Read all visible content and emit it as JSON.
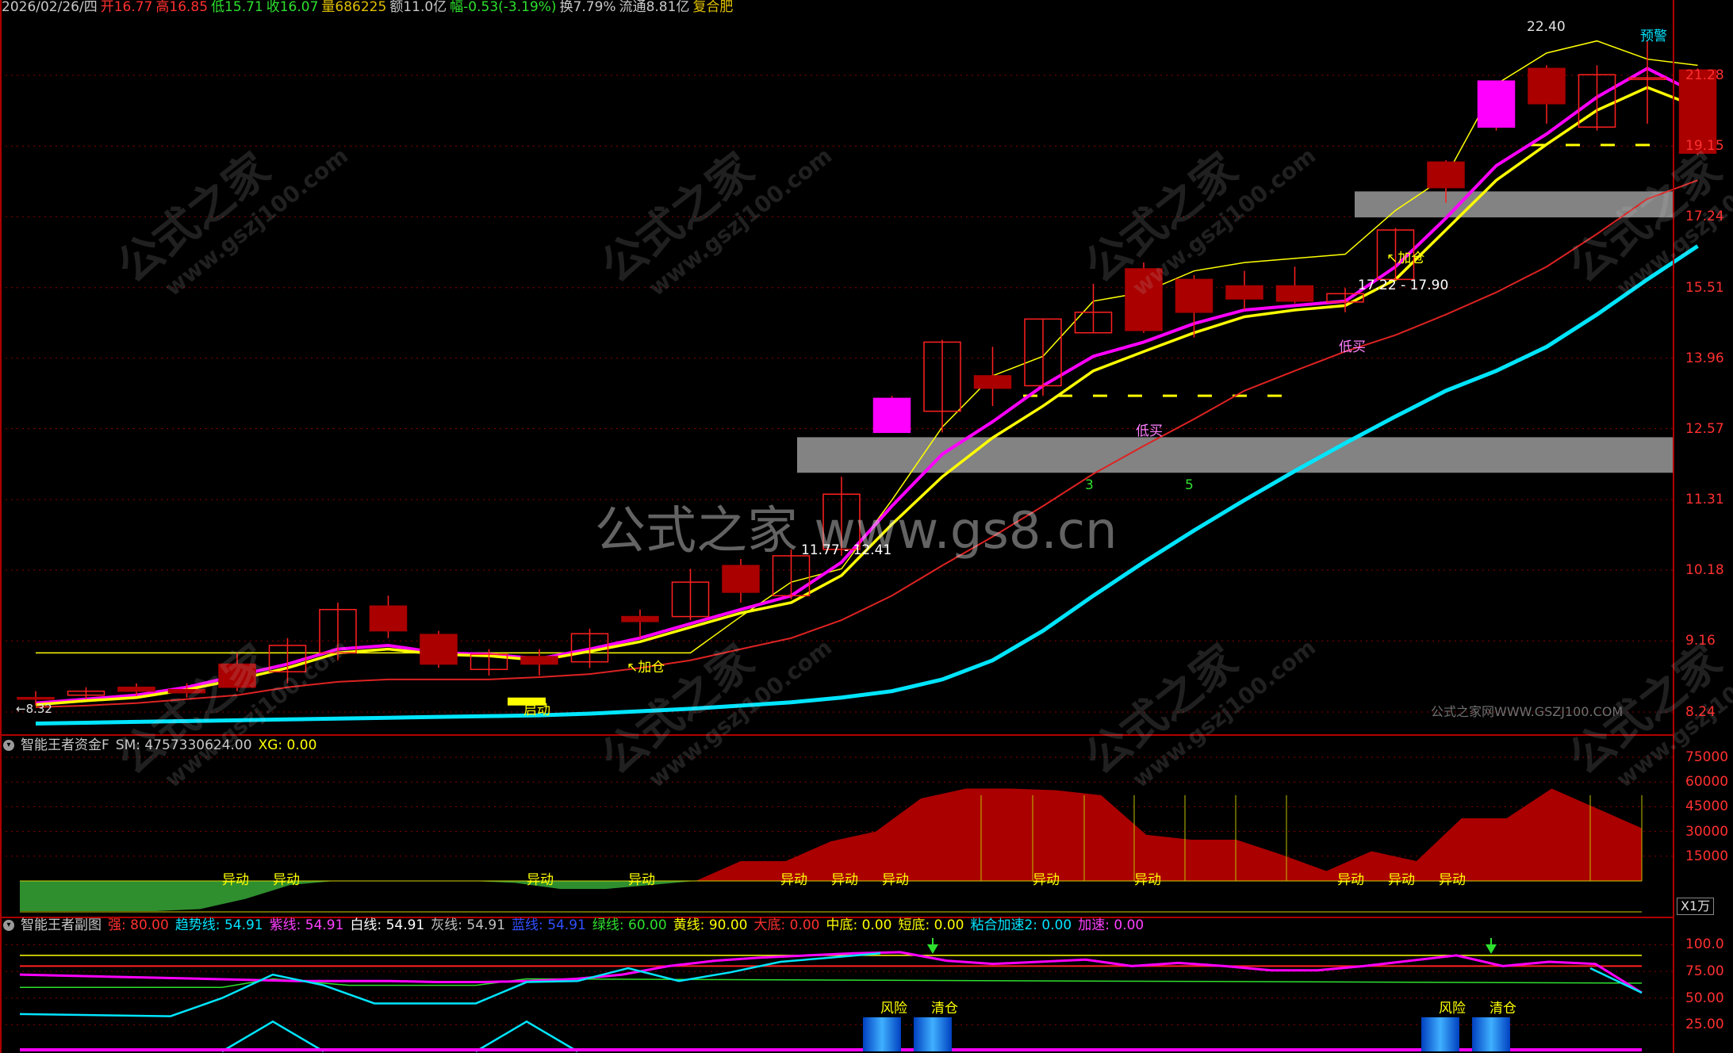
{
  "info_bar": {
    "date": "2026/02/26/四",
    "open": "开16.77",
    "high": "高16.85",
    "low": "低15.71",
    "close": "收16.07",
    "volume": "量686225",
    "amount": "额11.0亿",
    "change": "幅-0.53(-3.19%)",
    "turnover": "换7.79%",
    "float": "流通8.81亿",
    "name": "复合肥"
  },
  "main_chart": {
    "price_axis": [
      "21.28",
      "19.15",
      "17.24",
      "15.51",
      "13.96",
      "12.57",
      "11.31",
      "10.18",
      "9.16",
      "8.24"
    ],
    "labels": {
      "peak": "22.40",
      "warn": "预警",
      "add1": "↖加仓",
      "add2": "↖加仓",
      "range1": "17.22 - 17.90",
      "range2": "11.77 - 12.41",
      "low_buy1": "低买",
      "low_buy2": "低买",
      "start": "启动",
      "low_mark": "←8.32",
      "n3": "3",
      "n5": "5",
      "source": "公式之家网WWW.GSZJ100.COM"
    },
    "candles": [
      {
        "o": 8.42,
        "c": 8.4,
        "h": 8.5,
        "l": 8.32
      },
      {
        "o": 8.45,
        "c": 8.5,
        "h": 8.55,
        "l": 8.4
      },
      {
        "o": 8.55,
        "c": 8.5,
        "h": 8.6,
        "l": 8.44
      },
      {
        "o": 8.52,
        "c": 8.48,
        "h": 8.6,
        "l": 8.42
      },
      {
        "o": 8.85,
        "c": 8.55,
        "h": 9.0,
        "l": 8.5
      },
      {
        "o": 8.75,
        "c": 9.1,
        "h": 9.2,
        "l": 8.6
      },
      {
        "o": 9.0,
        "c": 9.6,
        "h": 9.7,
        "l": 8.9
      },
      {
        "o": 9.65,
        "c": 9.3,
        "h": 9.8,
        "l": 9.2
      },
      {
        "o": 9.25,
        "c": 8.85,
        "h": 9.3,
        "l": 8.8
      },
      {
        "o": 8.78,
        "c": 8.98,
        "h": 9.05,
        "l": 8.7
      },
      {
        "o": 8.95,
        "c": 8.85,
        "h": 9.05,
        "l": 8.7
      },
      {
        "o": 8.88,
        "c": 9.26,
        "h": 9.33,
        "l": 8.8
      },
      {
        "o": 9.5,
        "c": 9.43,
        "h": 9.6,
        "l": 9.2
      },
      {
        "o": 9.5,
        "c": 10.0,
        "h": 10.2,
        "l": 9.45
      },
      {
        "o": 10.25,
        "c": 9.85,
        "h": 10.35,
        "l": 9.7
      },
      {
        "o": 9.8,
        "c": 10.4,
        "h": 10.5,
        "l": 9.75
      },
      {
        "o": 10.5,
        "c": 11.4,
        "h": 11.7,
        "l": 10.4
      },
      {
        "o": 12.5,
        "c": 13.15,
        "h": 13.2,
        "l": 12.5
      },
      {
        "o": 12.9,
        "c": 14.3,
        "h": 14.35,
        "l": 12.5
      },
      {
        "o": 13.6,
        "c": 13.35,
        "h": 14.2,
        "l": 13.0
      },
      {
        "o": 13.4,
        "c": 14.8,
        "h": 14.8,
        "l": 13.2
      },
      {
        "o": 14.5,
        "c": 14.95,
        "h": 15.6,
        "l": 14.5
      },
      {
        "o": 15.95,
        "c": 14.55,
        "h": 16.1,
        "l": 14.5
      },
      {
        "o": 15.7,
        "c": 14.95,
        "h": 15.8,
        "l": 14.4
      },
      {
        "o": 15.55,
        "c": 15.25,
        "h": 15.9,
        "l": 15.0
      },
      {
        "o": 15.55,
        "c": 15.2,
        "h": 16.0,
        "l": 15.15
      },
      {
        "o": 15.18,
        "c": 15.37,
        "h": 15.5,
        "l": 14.95
      },
      {
        "o": 15.7,
        "c": 16.9,
        "h": 16.95,
        "l": 15.7
      },
      {
        "o": 18.7,
        "c": 18.0,
        "h": 18.75,
        "l": 17.6
      },
      {
        "o": 19.7,
        "c": 21.1,
        "h": 21.1,
        "l": 19.6
      },
      {
        "o": 21.5,
        "c": 20.4,
        "h": 21.6,
        "l": 19.8
      },
      {
        "o": 19.7,
        "c": 21.3,
        "h": 21.6,
        "l": 19.6
      },
      {
        "o": 21.2,
        "c": 21.2,
        "h": 22.4,
        "l": 19.8
      },
      {
        "o": 21.45,
        "c": 18.95,
        "h": 21.5,
        "l": 18.9
      }
    ],
    "lines": {
      "yellow_thin": [
        9.0,
        9.0,
        9.0,
        9.0,
        9.0,
        9.0,
        9.0,
        9.0,
        9.0,
        9.0,
        9.0,
        9.0,
        9.0,
        9.0,
        9.5,
        10.0,
        10.2,
        11.3,
        12.6,
        13.6,
        14.0,
        15.2,
        15.4,
        15.9,
        16.1,
        16.2,
        16.3,
        17.4,
        18.3,
        21.0,
        22.0,
        22.4,
        21.8,
        21.6
      ],
      "magenta": [
        8.35,
        8.4,
        8.45,
        8.55,
        8.7,
        8.85,
        9.05,
        9.1,
        9.0,
        8.98,
        8.92,
        9.05,
        9.2,
        9.4,
        9.6,
        9.8,
        10.3,
        11.2,
        12.1,
        12.7,
        13.4,
        14.0,
        14.3,
        14.7,
        15.0,
        15.1,
        15.2,
        16.0,
        17.2,
        18.6,
        19.5,
        20.6,
        21.5,
        20.7
      ],
      "yellow_thick": [
        8.33,
        8.38,
        8.42,
        8.52,
        8.65,
        8.8,
        9.0,
        9.05,
        8.98,
        8.96,
        8.9,
        9.02,
        9.15,
        9.35,
        9.55,
        9.7,
        10.1,
        10.9,
        11.7,
        12.4,
        13.0,
        13.7,
        14.1,
        14.5,
        14.85,
        15.0,
        15.1,
        15.7,
        16.9,
        18.2,
        19.2,
        20.2,
        20.9,
        20.3
      ],
      "red": [
        8.3,
        8.32,
        8.35,
        8.4,
        8.45,
        8.55,
        8.62,
        8.65,
        8.65,
        8.65,
        8.68,
        8.72,
        8.8,
        8.9,
        9.05,
        9.2,
        9.45,
        9.8,
        10.25,
        10.7,
        11.2,
        11.75,
        12.25,
        12.75,
        13.3,
        13.7,
        14.1,
        14.45,
        14.9,
        15.4,
        16.0,
        16.8,
        17.7,
        18.2
      ],
      "cyan": [
        8.1,
        8.11,
        8.12,
        8.13,
        8.14,
        8.15,
        8.16,
        8.17,
        8.18,
        8.19,
        8.2,
        8.22,
        8.25,
        8.28,
        8.32,
        8.36,
        8.42,
        8.5,
        8.65,
        8.9,
        9.3,
        9.8,
        10.3,
        10.8,
        11.3,
        11.8,
        12.3,
        12.8,
        13.3,
        13.7,
        14.2,
        14.9,
        15.7,
        16.5
      ]
    }
  },
  "capital_panel": {
    "title": "智能王者资金F",
    "sm": "SM: 4757330624.00",
    "xg": "XG: 0.00",
    "axis": [
      "75000",
      "60000",
      "45000",
      "30000",
      "15000"
    ],
    "unit": "X1万",
    "values": [
      -15000,
      -15000,
      -15000,
      -15000,
      -14000,
      -9000,
      -2000,
      0,
      0,
      0,
      0,
      -1000,
      -4000,
      -4000,
      -2000,
      0,
      12000,
      12000,
      24000,
      30000,
      50000,
      56000,
      56000,
      55000,
      52000,
      28000,
      25000,
      25000,
      16000,
      6000,
      18000,
      12000,
      38000,
      38000,
      56000,
      44000,
      32000
    ],
    "yidong_label": "异动",
    "yidong_idx": [
      4,
      5,
      10,
      12,
      15,
      16,
      17,
      20,
      22,
      26,
      27,
      28
    ]
  },
  "sub_panel": {
    "title": "智能王者副图",
    "strong": "强: 80.00",
    "trend": "趋势线: 54.91",
    "purple": "紫线: 54.91",
    "white": "白线: 54.91",
    "gray": "灰线: 54.91",
    "blue": "蓝线: 54.91",
    "green": "绿线: 60.00",
    "yellow": "黄线: 90.00",
    "big_bottom": "大底: 0.00",
    "mid_bottom": "中底: 0.00",
    "short_bottom": "短底: 0.00",
    "accel2": "粘合加速2: 0.00",
    "accel": "加速: 0.00",
    "axis": [
      "100.0",
      "75.00",
      "50.00",
      "25.00"
    ],
    "risk": "风险",
    "clear": "清仓",
    "magenta_line": [
      72,
      71,
      70,
      69,
      68,
      67,
      66,
      66,
      66,
      65,
      65,
      66,
      68,
      72,
      80,
      85,
      88,
      90,
      92,
      93,
      85,
      82,
      84,
      86,
      80,
      83,
      80,
      76,
      76,
      80,
      85,
      90,
      80,
      84,
      82,
      55
    ],
    "cyan_line": [
      35,
      34,
      34,
      34,
      40,
      50,
      60,
      72,
      60,
      48,
      45,
      44,
      55,
      65,
      66,
      75,
      70,
      68,
      75,
      80,
      82,
      84,
      86,
      87,
      88,
      85,
      84,
      82,
      80,
      82,
      85,
      88,
      90,
      90,
      88,
      55
    ]
  },
  "colors": {
    "up": "#ff2020",
    "down": "#ff00ff",
    "bear_fill": "#aa0000",
    "grid": "#8b0000",
    "yellow": "#ffff00",
    "cyan": "#00e5ff",
    "magenta": "#ff00ff",
    "red_line": "#dd2222",
    "green_fill": "#2f8f2f",
    "gray_band": "#8a8a8a"
  },
  "watermark": {
    "main": "公式之家",
    "url": "www.gszj100.com",
    "center": "公式之家 www.gs8.cn"
  }
}
